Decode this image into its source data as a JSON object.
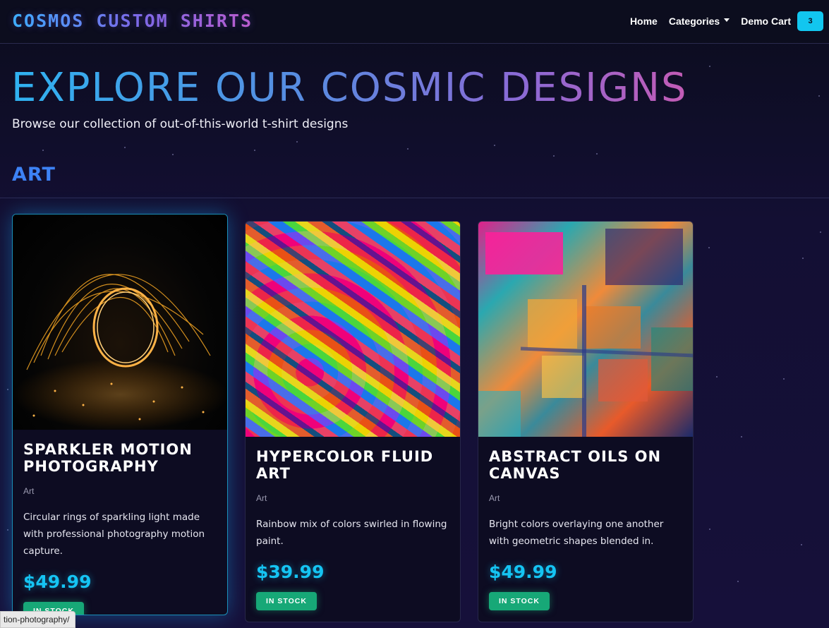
{
  "navbar": {
    "brand": "COSMOS CUSTOM SHIRTS",
    "links": [
      {
        "label": "Home"
      },
      {
        "label": "Categories"
      },
      {
        "label": "Demo Cart"
      }
    ],
    "cart_count": "3"
  },
  "hero": {
    "title": "EXPLORE OUR COSMIC DESIGNS",
    "subtitle": "Browse our collection of out-of-this-world t-shirt designs"
  },
  "section": {
    "title": "ART"
  },
  "products": [
    {
      "title": "SPARKLER MOTION PHOTOGRAPHY",
      "category": "Art",
      "description": "Circular rings of sparkling light made with professional photography motion capture.",
      "price": "$49.99",
      "stock": "IN STOCK"
    },
    {
      "title": "HYPERCOLOR FLUID ART",
      "category": "Art",
      "description": "Rainbow mix of colors swirled in flowing paint.",
      "price": "$39.99",
      "stock": "IN STOCK"
    },
    {
      "title": "ABSTRACT OILS ON CANVAS",
      "category": "Art",
      "description": "Bright colors overlaying one another with geometric shapes blended in.",
      "price": "$49.99",
      "stock": "IN STOCK"
    }
  ],
  "status_bar": {
    "url": "tion-photography/"
  },
  "colors": {
    "accent_cyan": "#15c4f3",
    "section_blue": "#3d82f5",
    "stock_green": "#17a877",
    "background": "#130f33"
  }
}
